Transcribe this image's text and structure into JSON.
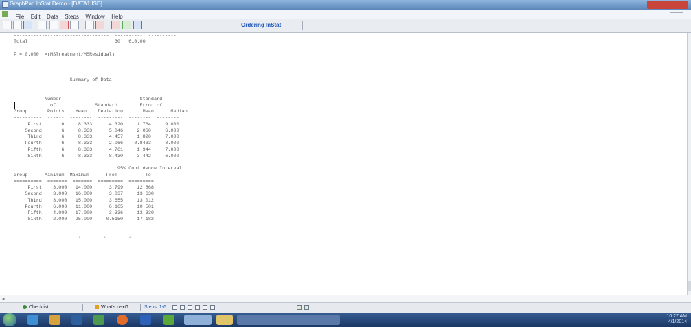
{
  "window": {
    "title": "GraphPad InStat Demo - [DATA1.ISD]",
    "menu": [
      "File",
      "Edit",
      "Data",
      "Steps",
      "Window",
      "Help"
    ]
  },
  "toolbar": {
    "order_link": "Ordering InStat"
  },
  "output": {
    "total_line": "Total                               30   610.00",
    "f_line": "F = 0.000  =(MSTreatment/MSResidual)",
    "summary_title": "Summary of Data",
    "table1_header": [
      "           Number                            Standard",
      "             of              Standard        Error of",
      "Group       Points    Mean    Deviation       Mean      Median"
    ],
    "table1_rows": [
      {
        "group": "First",
        "n": "6",
        "mean": "8.333",
        "sd": "4.320",
        "sem": "1.764",
        "median": "9.000"
      },
      {
        "group": "Second",
        "n": "6",
        "mean": "8.333",
        "sd": "5.046",
        "sem": "2.060",
        "median": "6.000"
      },
      {
        "group": "Third",
        "n": "6",
        "mean": "8.333",
        "sd": "4.457",
        "sem": "1.820",
        "median": "7.000"
      },
      {
        "group": "Fourth",
        "n": "6",
        "mean": "8.333",
        "sd": "2.066",
        "sem": "0.8433",
        "median": "8.000"
      },
      {
        "group": "Fifth",
        "n": "6",
        "mean": "8.333",
        "sd": "4.761",
        "sem": "1.944",
        "median": "7.000"
      },
      {
        "group": "Sixth",
        "n": "6",
        "mean": "8.333",
        "sd": "8.430",
        "sem": "3.442",
        "median": "6.000"
      }
    ],
    "table2_header": [
      "                                     95% Confidence Interval",
      "Group      Minimum  Maximum      From          To"
    ],
    "table2_rows": [
      {
        "group": "First",
        "min": "3.000",
        "max": "14.000",
        "from": "3.799",
        "to": "12.868"
      },
      {
        "group": "Second",
        "min": "3.000",
        "max": "16.000",
        "from": "3.037",
        "to": "13.630"
      },
      {
        "group": "Third",
        "min": "3.000",
        "max": "15.000",
        "from": "3.655",
        "to": "13.012"
      },
      {
        "group": "Fourth",
        "min": "6.000",
        "max": "11.000",
        "from": "6.165",
        "to": "10.501"
      },
      {
        "group": "Fifth",
        "min": "4.000",
        "max": "17.000",
        "from": "3.336",
        "to": "13.330"
      },
      {
        "group": "Sixth",
        "min": "2.000",
        "max": "25.000",
        "from": "-0.5150",
        "to": "17.182"
      }
    ],
    "end_marks": "                       *        *        *"
  },
  "steps_bar": {
    "checklist": "Checklist",
    "whats_next": "What's next?",
    "steps": "Steps: 1-6"
  },
  "tray": {
    "time": "10:27 AM",
    "date": "4/1/2014"
  }
}
